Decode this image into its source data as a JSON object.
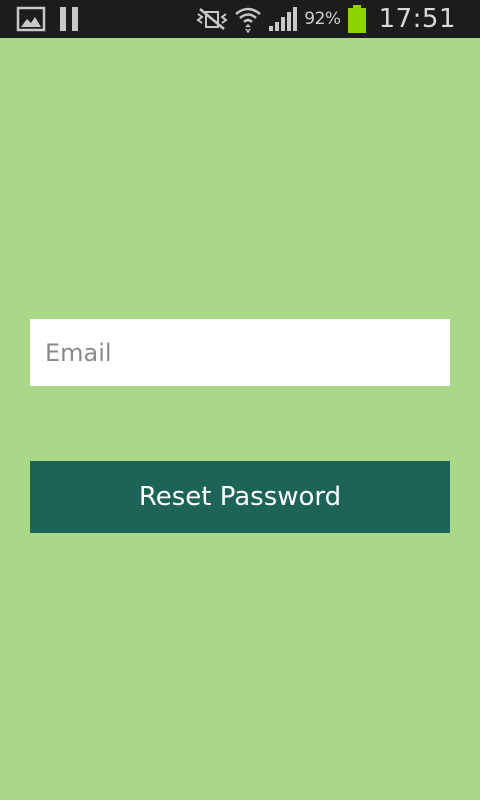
{
  "status_bar": {
    "left_icons": [
      "gallery-icon",
      "pause-icon"
    ],
    "right_icons": [
      "mute-vibrate-icon",
      "wifi-icon",
      "signal-icon",
      "battery-icon"
    ],
    "battery_percent": "92%",
    "time": "17:51",
    "battery_color": "#8ed400"
  },
  "form": {
    "email": {
      "placeholder": "Email",
      "value": ""
    },
    "reset_button_label": "Reset Password"
  },
  "colors": {
    "background": "#a8d888",
    "button": "#1e6358",
    "status_bar": "#1c1c1c"
  }
}
